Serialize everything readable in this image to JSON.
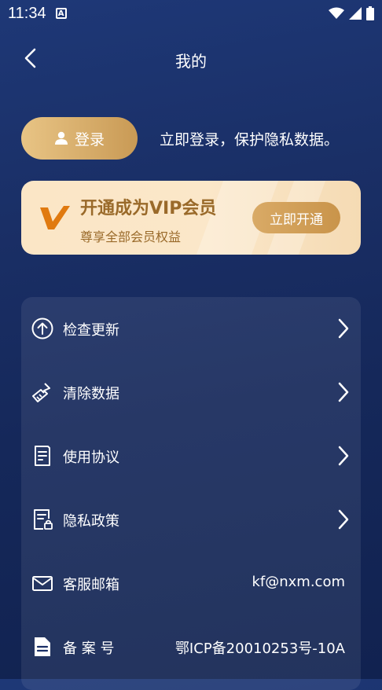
{
  "status_bar": {
    "time": "11:34",
    "a_badge": "A"
  },
  "header": {
    "title": "我的"
  },
  "login": {
    "button_label": "登录",
    "tip": "立即登录，保护隐私数据。"
  },
  "vip": {
    "title": "开通成为VIP会员",
    "subtitle": "尊享全部会员权益",
    "button_label": "立即开通"
  },
  "menu": {
    "items": [
      {
        "label": "检查更新",
        "icon": "upload-circle-icon"
      },
      {
        "label": "清除数据",
        "icon": "broom-icon"
      },
      {
        "label": "使用协议",
        "icon": "document-icon"
      },
      {
        "label": "隐私政策",
        "icon": "privacy-document-icon"
      },
      {
        "label": "客服邮箱",
        "icon": "mail-icon",
        "value": "kf@nxm.com"
      },
      {
        "label": "备 案 号",
        "icon": "file-icon",
        "value": "鄂ICP备20010253号-10A"
      }
    ]
  },
  "colors": {
    "gold": "#c99a55",
    "vip_text": "#9a6a2a",
    "background": "#1a2f66"
  }
}
